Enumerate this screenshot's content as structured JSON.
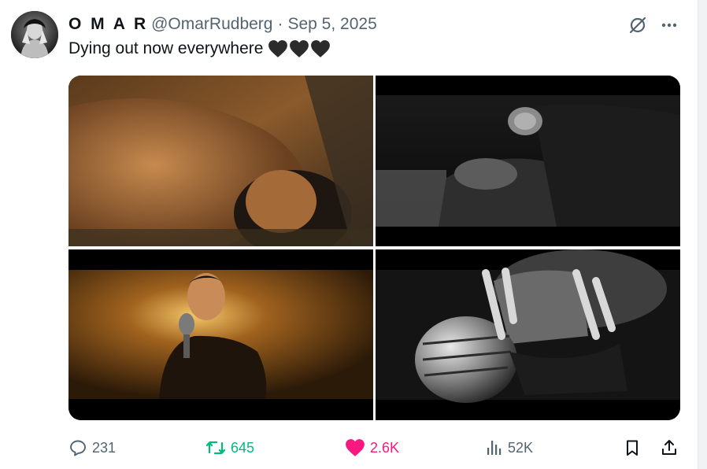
{
  "tweet": {
    "display_name": "O M A R",
    "handle": "@OmarRudberg",
    "separator": "·",
    "date": "Sep 5, 2025",
    "text": "Dying out now everywhere",
    "emoji": [
      "black-heart",
      "black-heart",
      "black-heart"
    ]
  },
  "media": [
    {
      "id": "photo-1",
      "tone": "warm-gold",
      "description_icon": "image"
    },
    {
      "id": "photo-2",
      "tone": "black-white",
      "description_icon": "image"
    },
    {
      "id": "photo-3",
      "tone": "warm-amber",
      "description_icon": "image"
    },
    {
      "id": "photo-4",
      "tone": "black-white",
      "description_icon": "image"
    }
  ],
  "actions": {
    "replies": "231",
    "retweets": "645",
    "likes": "2.6K",
    "views": "52K"
  },
  "colors": {
    "text_primary": "#0f1419",
    "text_secondary": "#536471",
    "retweet_active": "#00ba7c",
    "like_active": "#f91880"
  }
}
